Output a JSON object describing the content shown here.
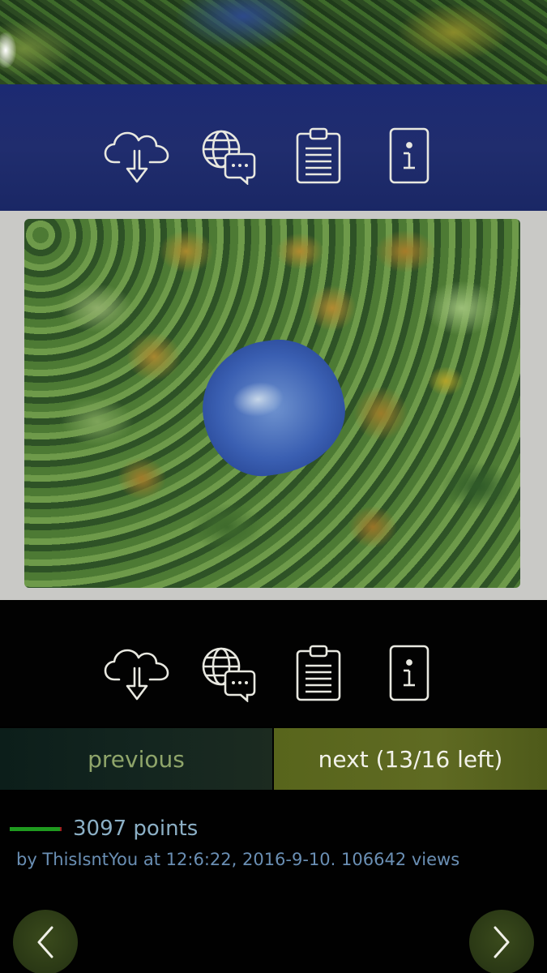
{
  "toolbar": {
    "icons": [
      "cloud-download-icon",
      "translate-chat-icon",
      "clipboard-icon",
      "info-icon"
    ]
  },
  "navigation": {
    "previous_label": "previous",
    "next_label": "next (13/16 left)"
  },
  "post": {
    "points": "3097 points",
    "meta": "by ThisIsntYou at 12:6:22, 2016-9-10. 106642 views"
  },
  "colors": {
    "band_blue": "#1e2b6f",
    "icon_stroke": "#e8e8e0",
    "next_bg": "#5a661e",
    "previous_text": "#8fa56a",
    "score_green": "#1f9a1f",
    "meta_text": "#6a8fb4"
  },
  "arrows": {
    "left_icon": "chevron-left-icon",
    "right_icon": "chevron-right-icon"
  }
}
